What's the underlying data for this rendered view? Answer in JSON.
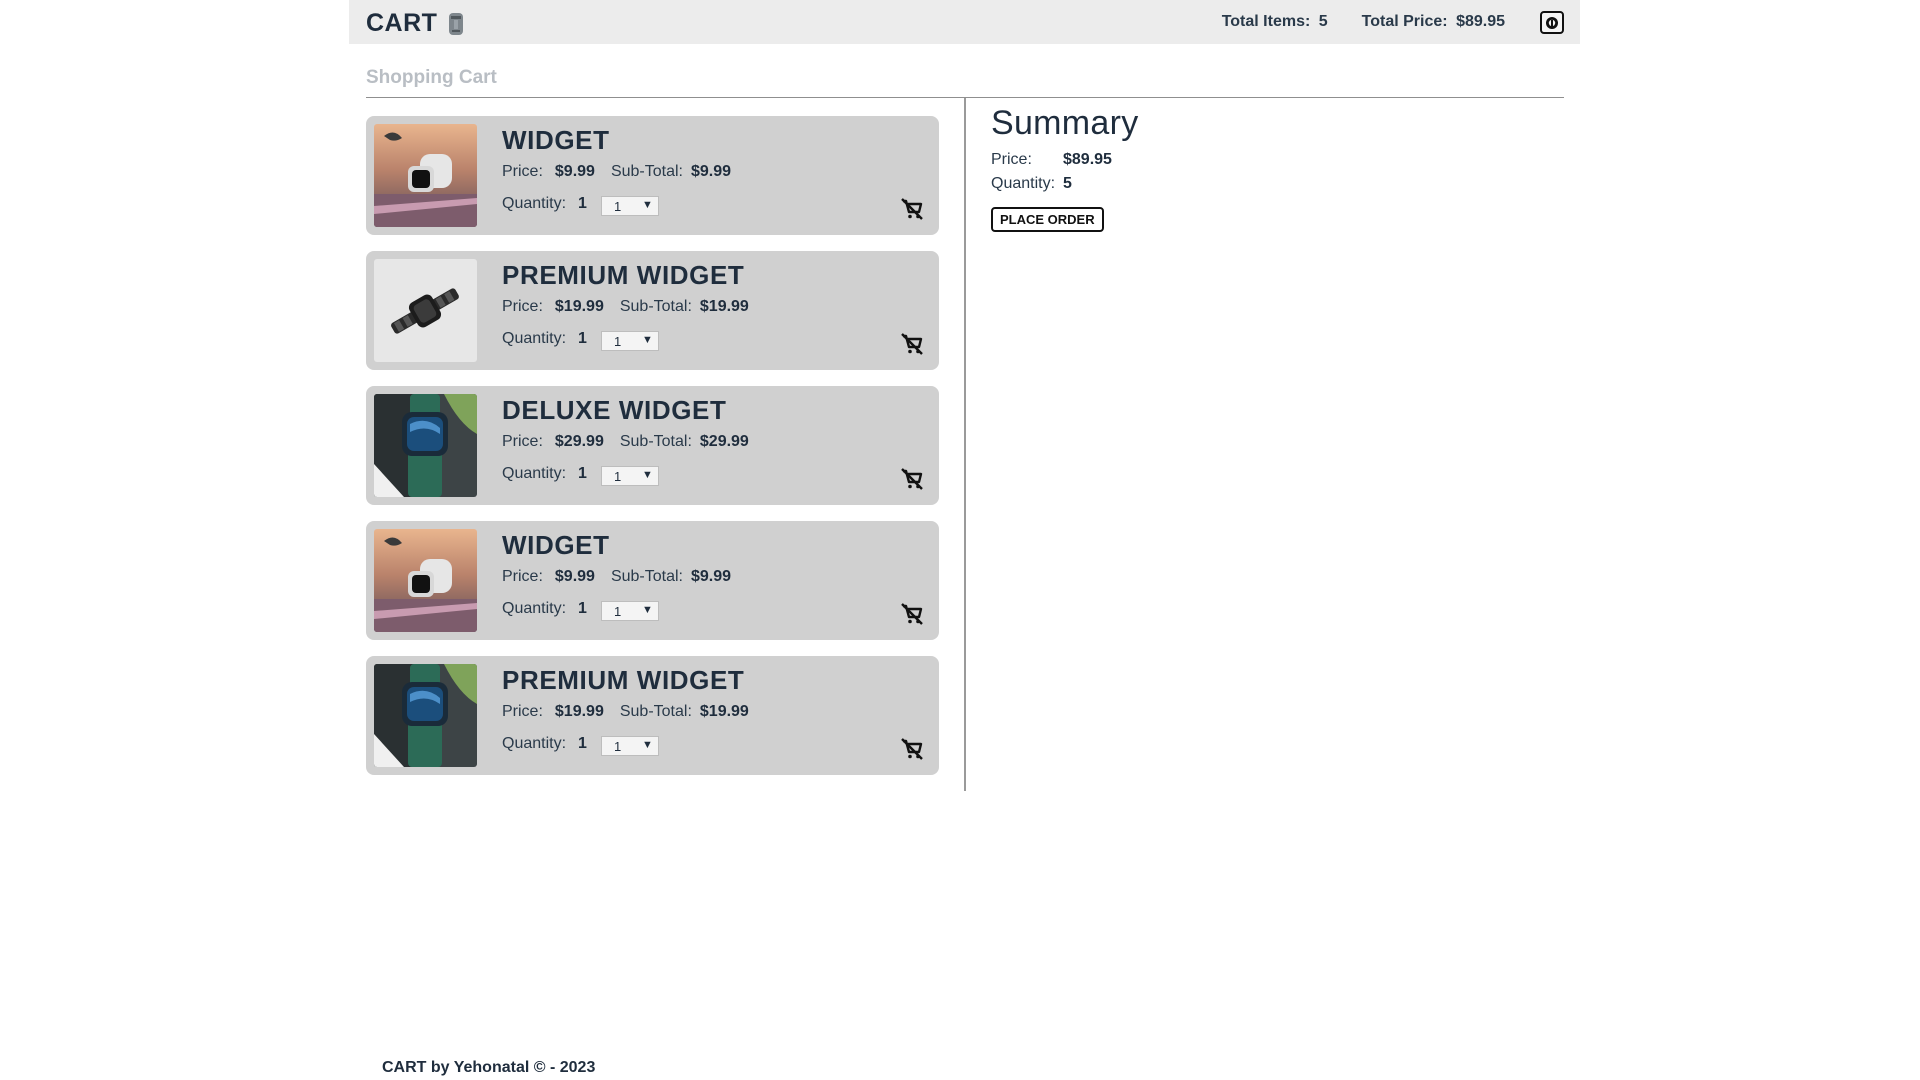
{
  "header": {
    "brand": "CART",
    "total_items_label": "Total Items:",
    "total_items": "5",
    "total_price_label": "Total Price:",
    "total_price": "$89.95"
  },
  "section_title": "Shopping Cart",
  "labels": {
    "price": "Price:",
    "subtotal": "Sub-Total:",
    "quantity": "Quantity:"
  },
  "items": [
    {
      "name": "WIDGET",
      "price": "$9.99",
      "subtotal": "$9.99",
      "quantity": "1",
      "selected_qty": "1",
      "image": "watch-on-laptop"
    },
    {
      "name": "PREMIUM WIDGET",
      "price": "$19.99",
      "subtotal": "$19.99",
      "quantity": "1",
      "selected_qty": "1",
      "image": "black-link-watch"
    },
    {
      "name": "DELUXE WIDGET",
      "price": "$29.99",
      "subtotal": "$29.99",
      "quantity": "1",
      "selected_qty": "1",
      "image": "green-strap-watch"
    },
    {
      "name": "WIDGET",
      "price": "$9.99",
      "subtotal": "$9.99",
      "quantity": "1",
      "selected_qty": "1",
      "image": "watch-on-laptop"
    },
    {
      "name": "PREMIUM WIDGET",
      "price": "$19.99",
      "subtotal": "$19.99",
      "quantity": "1",
      "selected_qty": "1",
      "image": "green-strap-watch"
    }
  ],
  "summary": {
    "title": "Summary",
    "price_label": "Price:",
    "price": "$89.95",
    "quantity_label": "Quantity:",
    "quantity": "5",
    "place_order": "PLACE ORDER"
  },
  "footer": "CART by Yehonatal © - 2023",
  "colors": {
    "header_bg": "#ececec",
    "card_bg": "#d0d0d0",
    "text_dark": "#1f2d3d",
    "section_title": "#b9bec4"
  }
}
